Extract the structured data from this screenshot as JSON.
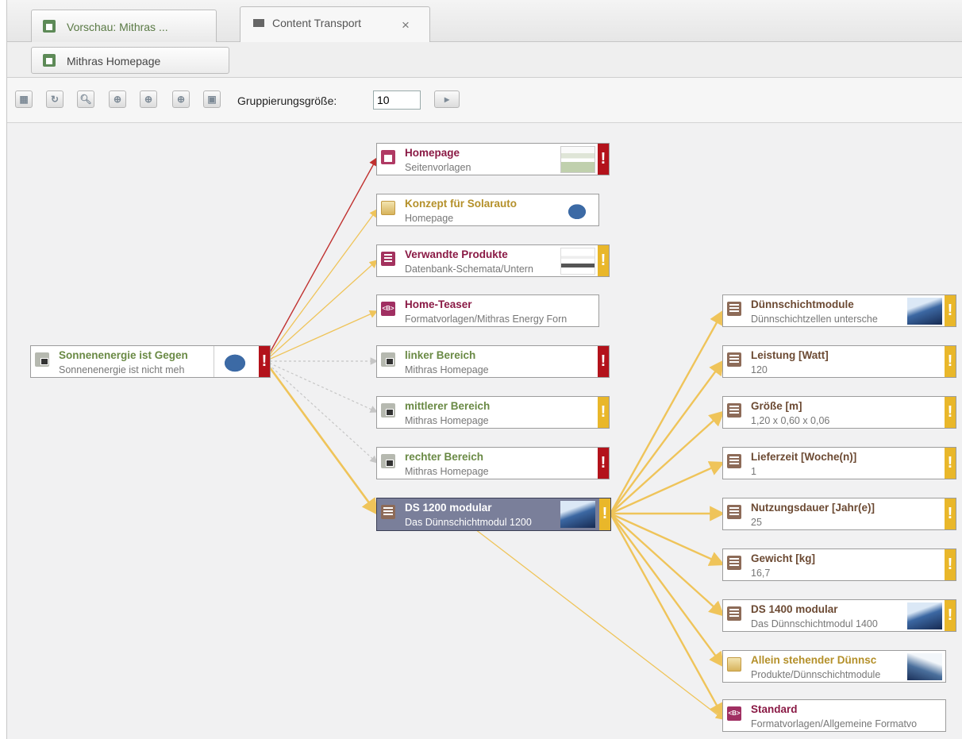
{
  "tabs": [
    {
      "label": "Vorschau: Mithras ...",
      "close": ""
    },
    {
      "label": "Content Transport",
      "close": "×"
    }
  ],
  "subtab": {
    "label": "Mithras Homepage"
  },
  "toolbar": {
    "buttons": [
      "layout-icon",
      "refresh-icon",
      "zoom-out-icon",
      "zoom-in-icon",
      "zoom-fit-icon",
      "zoom-reset-icon",
      "save-icon"
    ],
    "grouping_label": "Gruppierungsgröße:",
    "grouping_value": "10"
  },
  "root": {
    "title": "Sonnenenergie ist Gegen",
    "subtitle": "Sonnenenergie ist nicht meh"
  },
  "middle": [
    {
      "title": "Homepage",
      "subtitle": "Seitenvorlagen"
    },
    {
      "title": "Konzept für Solarauto",
      "subtitle": "Homepage"
    },
    {
      "title": "Verwandte Produkte",
      "subtitle": "Datenbank-Schemata/Untern"
    },
    {
      "title": "Home-Teaser",
      "subtitle": "Formatvorlagen/Mithras Energy Forn"
    },
    {
      "title": "linker Bereich",
      "subtitle": "Mithras Homepage"
    },
    {
      "title": "mittlerer Bereich",
      "subtitle": "Mithras Homepage"
    },
    {
      "title": "rechter Bereich",
      "subtitle": "Mithras Homepage"
    },
    {
      "title": "DS 1200 modular",
      "subtitle": "Das Dünnschichtmodul 1200"
    }
  ],
  "right": [
    {
      "title": "Dünnschichtmodule",
      "subtitle": "Dünnschichtzellen untersche"
    },
    {
      "title": "Leistung [Watt]",
      "subtitle": "120"
    },
    {
      "title": "Größe [m]",
      "subtitle": "1,20 x 0,60 x 0,06"
    },
    {
      "title": "Lieferzeit [Woche(n)]",
      "subtitle": "1"
    },
    {
      "title": "Nutzungsdauer [Jahr(e)]",
      "subtitle": "25"
    },
    {
      "title": "Gewicht [kg]",
      "subtitle": "16,7"
    },
    {
      "title": "DS 1400 modular",
      "subtitle": "Das Dünnschichtmodul 1400"
    },
    {
      "title": "Allein stehender Dünnsc",
      "subtitle": "Produkte/Dünnschichtmodule"
    },
    {
      "title": "Standard",
      "subtitle": "Formatvorlagen/Allgemeine Formatvo"
    }
  ],
  "warn_glyph": "!",
  "colors": {
    "edge_red": "#c0312f",
    "edge_yellow": "#efc45a",
    "edge_gray": "#c6c6c6",
    "warn_red": "#b3121b",
    "warn_yellow": "#e9b72a"
  }
}
